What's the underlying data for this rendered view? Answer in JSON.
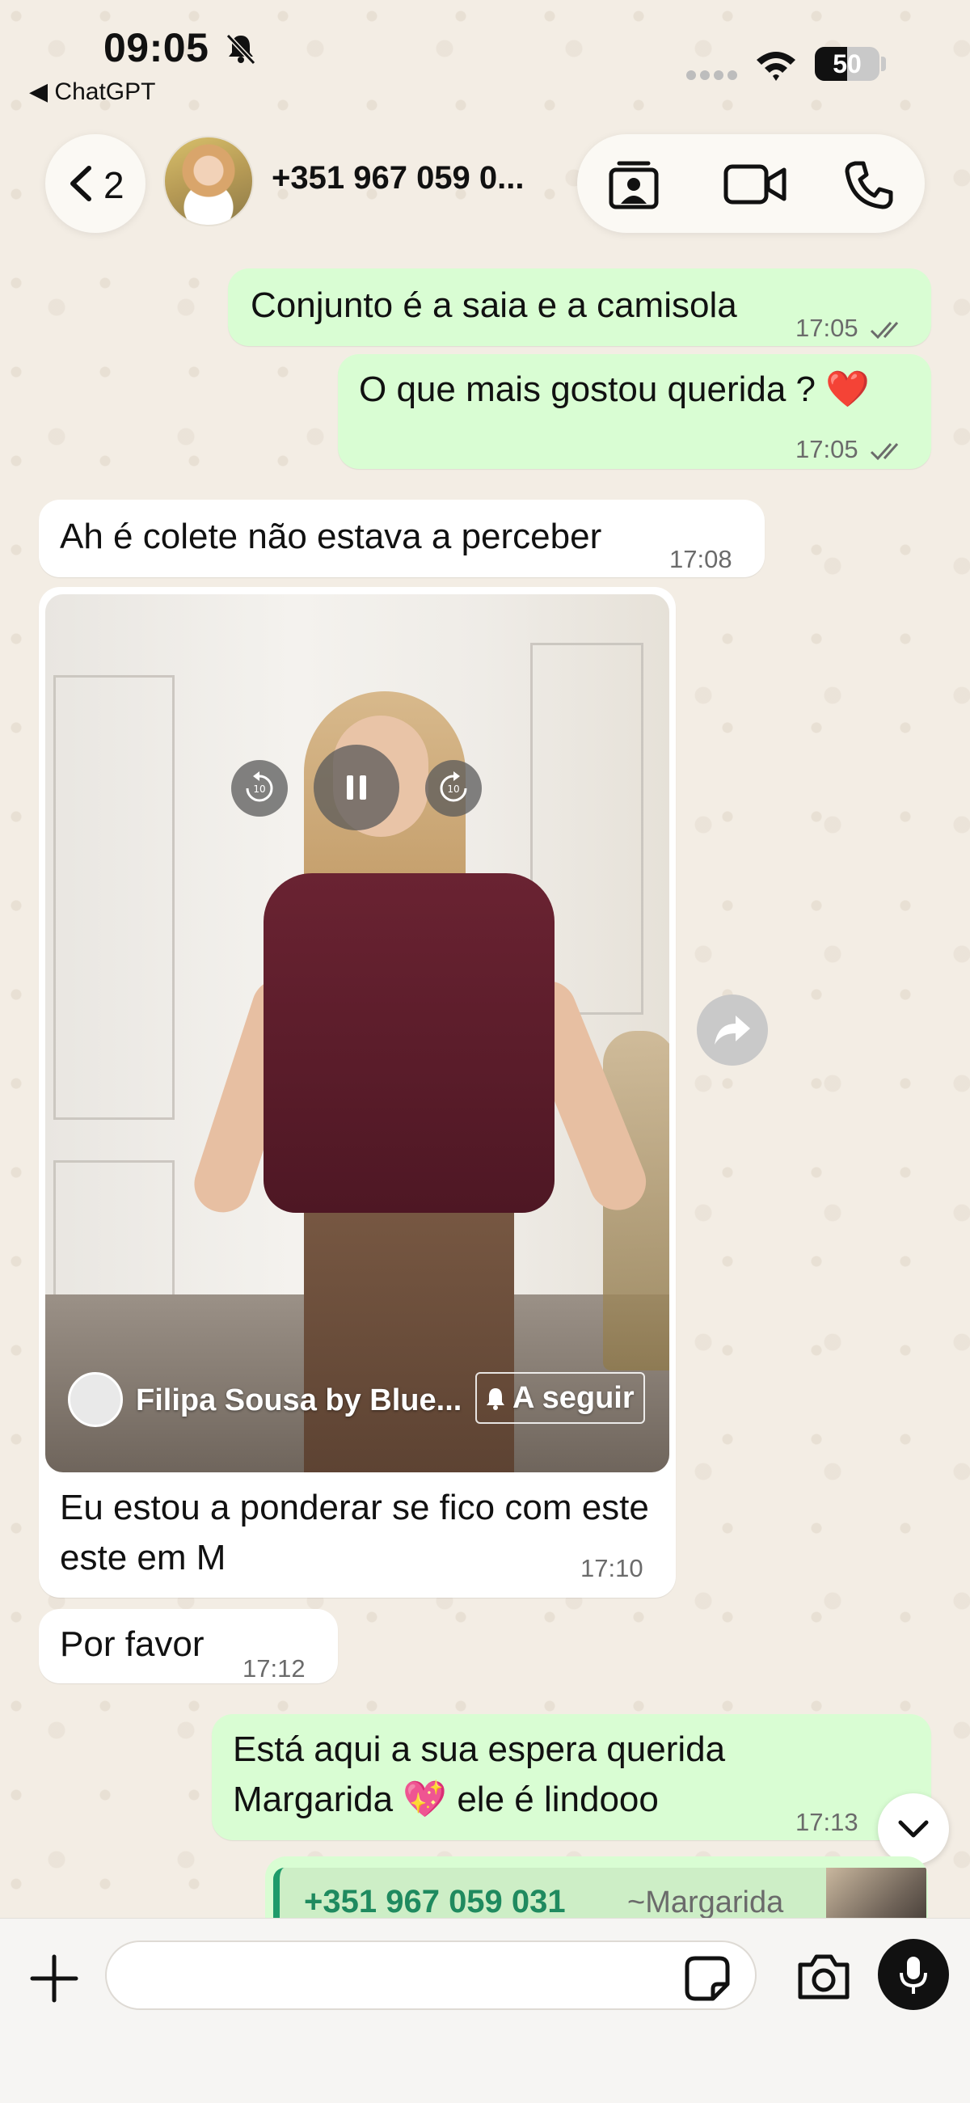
{
  "status_bar": {
    "time": "09:05",
    "back_app": "◀ ChatGPT",
    "battery": "50",
    "battery_level": 0.5
  },
  "header": {
    "back_count": "2",
    "contact_name": "+351 967 059 0..."
  },
  "messages": [
    {
      "id": "m1",
      "direction": "outgoing",
      "text": "Conjunto é a saia e a camisola",
      "time": "17:05"
    },
    {
      "id": "m2",
      "direction": "outgoing",
      "text": "O que mais gostou querida ? ❤️",
      "time": "17:05"
    },
    {
      "id": "m3",
      "direction": "incoming",
      "text": "Ah é colete não estava a perceber",
      "time": "17:08"
    },
    {
      "id": "m4",
      "direction": "incoming",
      "type": "video",
      "channel_name": "Filipa Sousa by Blue...",
      "follow_label": "A seguir",
      "caption": "Eu estou a ponderar se fico com este este em M",
      "time": "17:10"
    },
    {
      "id": "m5",
      "direction": "incoming",
      "text": "Por favor",
      "time": "17:12"
    },
    {
      "id": "m6",
      "direction": "outgoing",
      "text_line1": "Está aqui a sua espera querida",
      "text_line2": "Margarida 💖 ele é lindooo",
      "time": "17:13"
    }
  ],
  "quoted_contact": {
    "number": "+351 967 059 031",
    "alias": "~Margarida"
  },
  "composer": {
    "placeholder": ""
  },
  "colors": {
    "outgoing_bubble": "#d9fdd3",
    "incoming_bubble": "#ffffff",
    "accent_green": "#1f8a5f"
  },
  "icons": {
    "header": [
      "chevron-left-icon",
      "contact-card-icon",
      "video-call-icon",
      "phone-icon"
    ],
    "video": [
      "rewind-10-icon",
      "pause-icon",
      "forward-10-icon",
      "bell-icon"
    ],
    "bottom": [
      "plus-icon",
      "sticker-icon",
      "camera-icon",
      "mic-icon"
    ]
  }
}
